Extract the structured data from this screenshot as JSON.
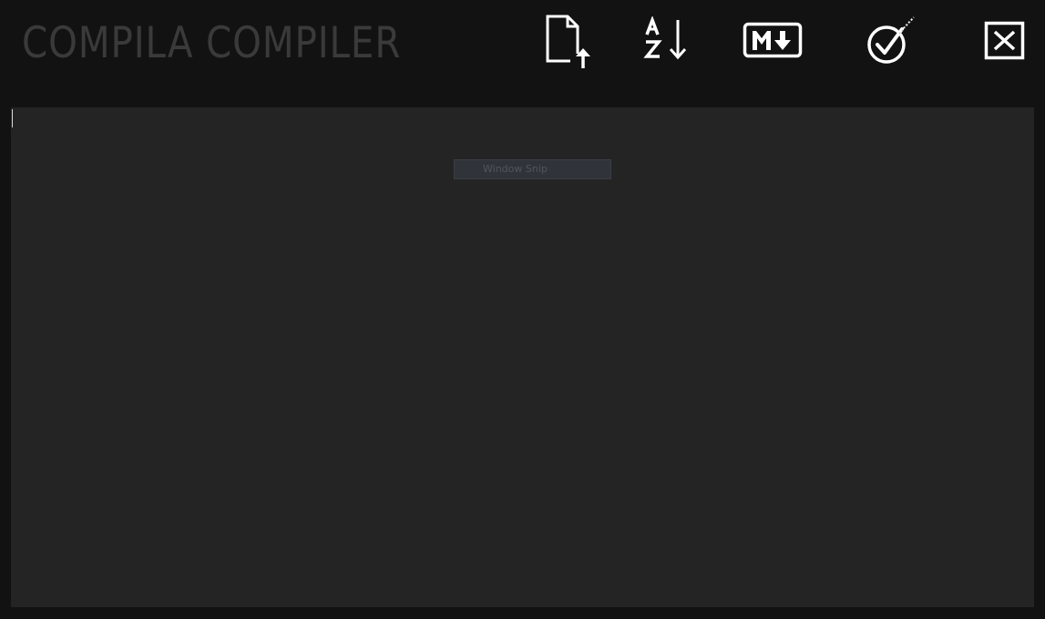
{
  "app": {
    "title": "COMPILA COMPILER"
  },
  "toolbar": {
    "buttons": [
      {
        "icon": "file-upload-icon",
        "action": "upload"
      },
      {
        "icon": "sort-a-z-icon",
        "action": "sort"
      },
      {
        "icon": "markdown-download-icon",
        "action": "markdown"
      },
      {
        "icon": "check-circle-icon",
        "action": "compile"
      },
      {
        "icon": "close-box-icon",
        "action": "close"
      }
    ]
  },
  "editor": {
    "tooltip": "Window Snip"
  },
  "colors": {
    "background": "#121212",
    "editor": "#242424",
    "title": "#3a3a3a",
    "icon": "#ffffff"
  }
}
